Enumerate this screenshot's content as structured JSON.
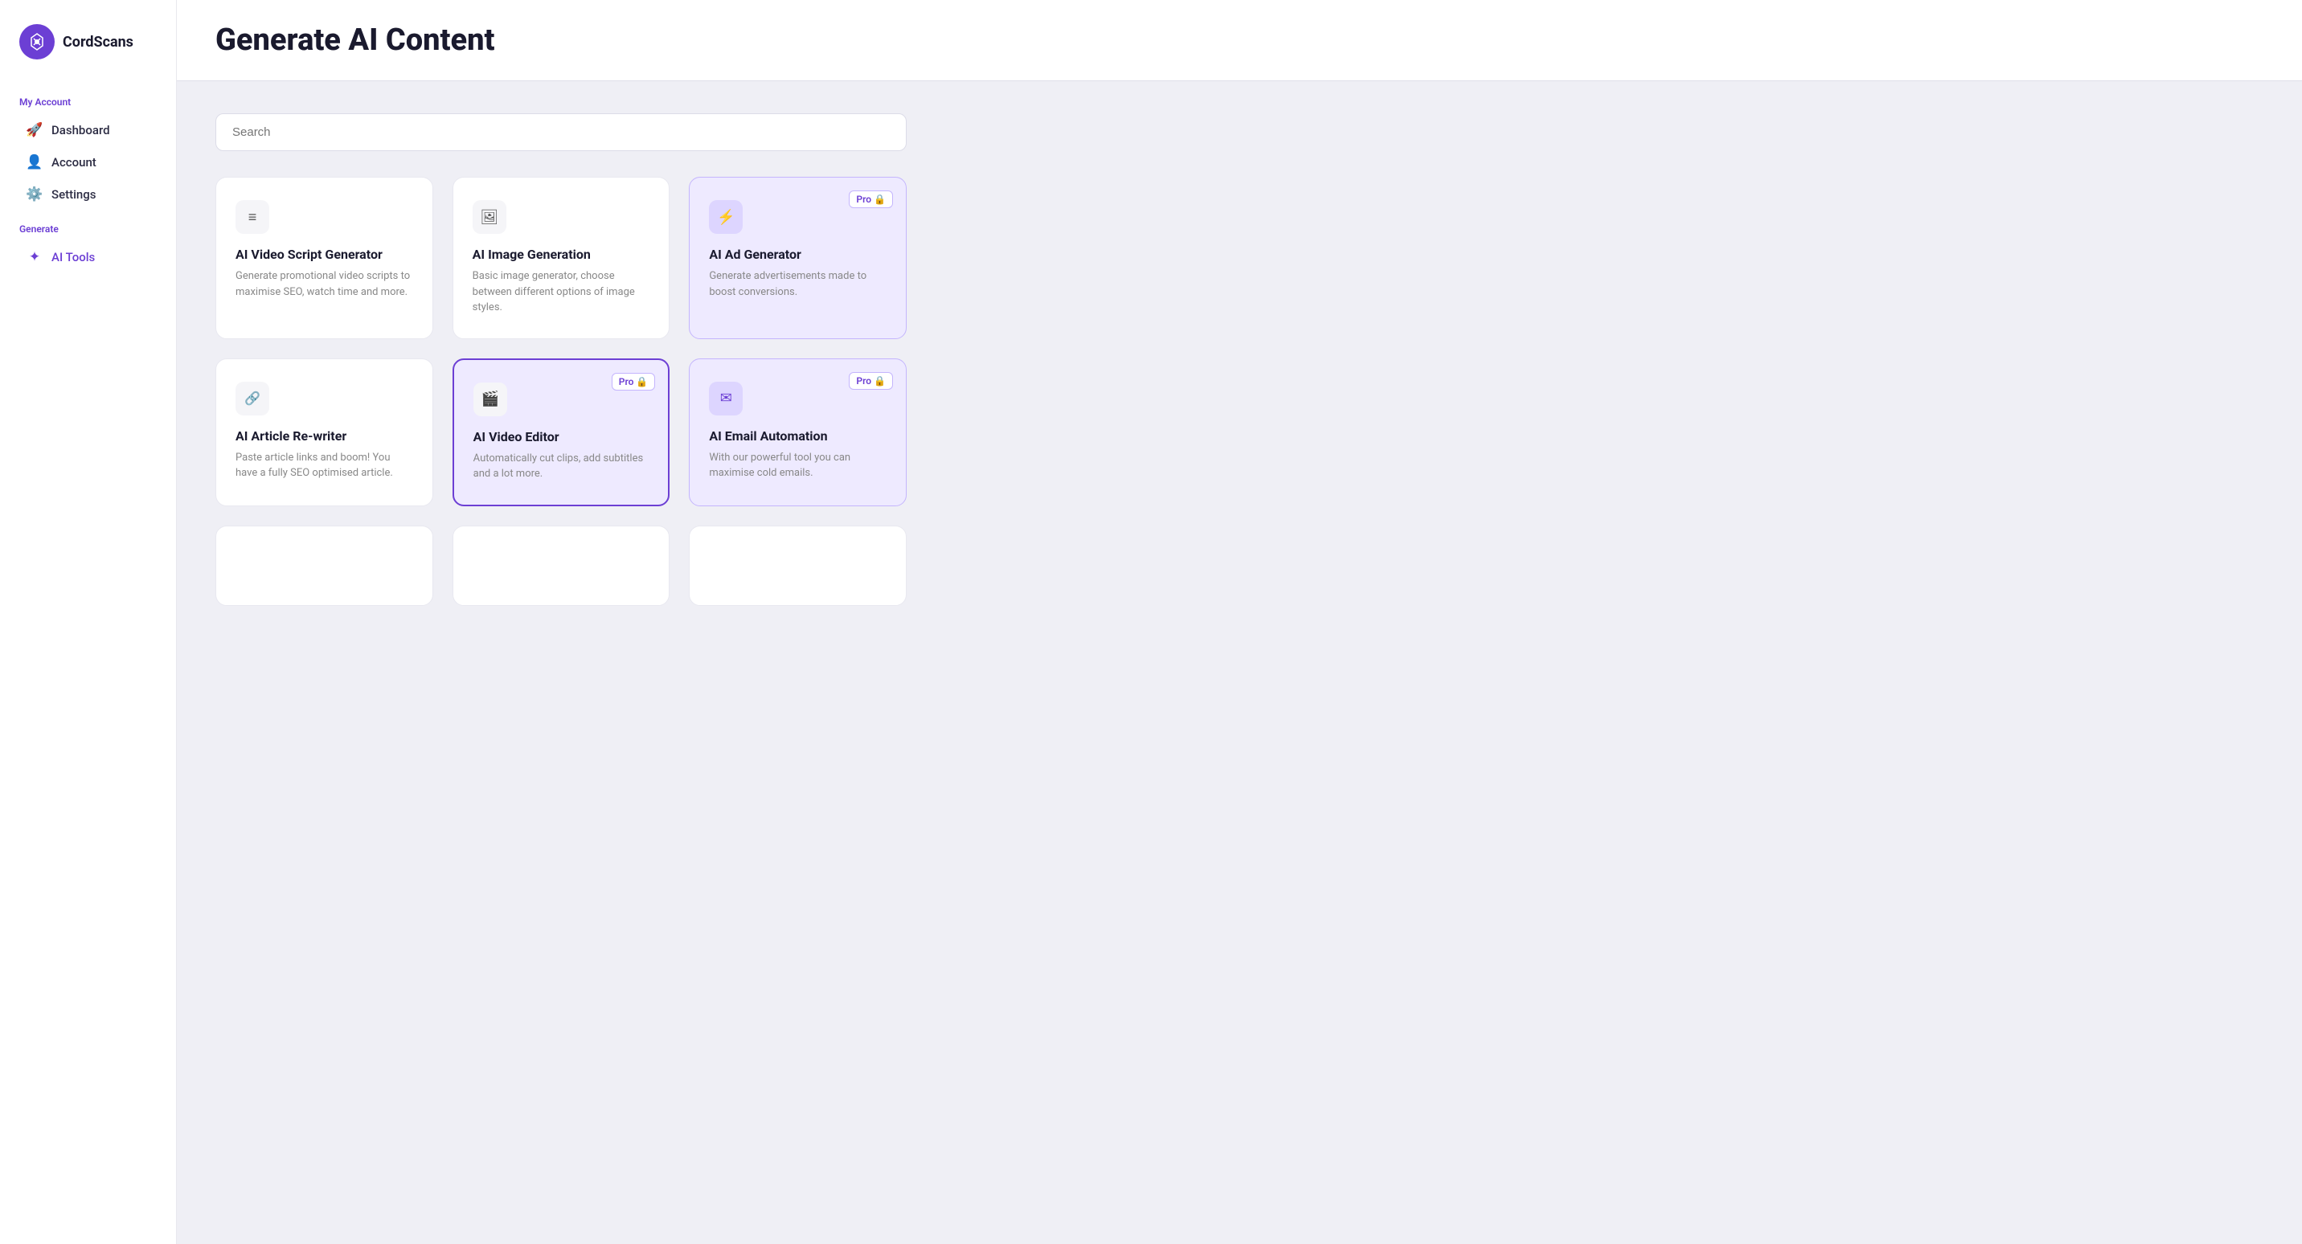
{
  "app": {
    "name": "CordScans"
  },
  "sidebar": {
    "my_account_label": "My Account",
    "generate_label": "Generate",
    "items": [
      {
        "id": "dashboard",
        "label": "Dashboard",
        "icon": "🚀"
      },
      {
        "id": "account",
        "label": "Account",
        "icon": "👤"
      },
      {
        "id": "settings",
        "label": "Settings",
        "icon": "⚙️"
      },
      {
        "id": "ai-tools",
        "label": "AI Tools",
        "icon": "✦"
      }
    ]
  },
  "main": {
    "page_title": "Generate AI Content",
    "search_placeholder": "Search",
    "cards": [
      {
        "id": "video-script",
        "title": "AI Video Script Generator",
        "desc": "Generate promotional video scripts to maximise SEO, watch time and more.",
        "icon": "≡",
        "pro": false
      },
      {
        "id": "image-gen",
        "title": "AI Image Generation",
        "desc": "Basic image generator, choose between different options of image styles.",
        "icon": "🖼",
        "pro": false
      },
      {
        "id": "ad-gen",
        "title": "AI Ad Generator",
        "desc": "Generate advertisements made to boost conversions.",
        "icon": "⚡",
        "pro": true
      },
      {
        "id": "article-rewriter",
        "title": "AI Article Re-writer",
        "desc": "Paste article links and boom! You have a fully SEO optimised article.",
        "icon": "🔗",
        "pro": false
      },
      {
        "id": "video-editor",
        "title": "AI Video Editor",
        "desc": "Automatically cut clips, add subtitles and a lot more.",
        "icon": "🎬",
        "pro": true,
        "selected": true
      },
      {
        "id": "email-automation",
        "title": "AI Email Automation",
        "desc": "With our powerful tool you can maximise cold emails.",
        "icon": "✉",
        "pro": true
      }
    ],
    "pro_label": "Pro 🔒"
  }
}
